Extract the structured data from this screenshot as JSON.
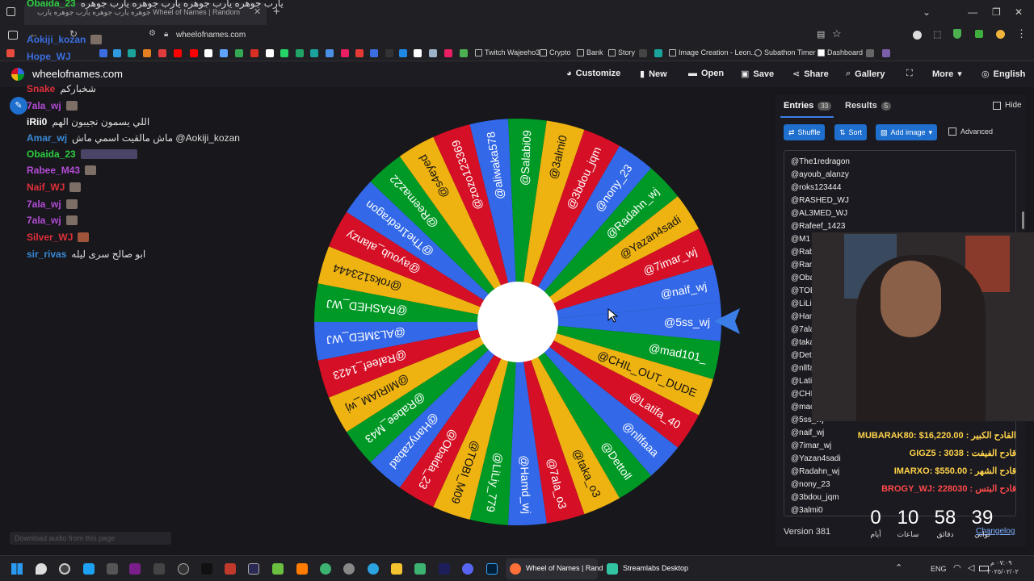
{
  "browser": {
    "tab_title": "جوهره يارب جوهره يارب جوهره يارب Wheel of Names | Random",
    "url": "wheelofnames.com",
    "bookmarks": [
      "Twitch Wajeeho3",
      "Crypto",
      "Bank",
      "Story",
      "Image Creation - Leon...",
      "Subathon Timer",
      "Dashboard"
    ]
  },
  "site": {
    "logo": "wheelofnames.com",
    "nav": [
      {
        "label": "Customize",
        "icon": "palette-icon"
      },
      {
        "label": "New",
        "icon": "file-icon"
      },
      {
        "label": "Open",
        "icon": "folder-icon"
      },
      {
        "label": "Save",
        "icon": "save-icon"
      },
      {
        "label": "Share",
        "icon": "share-icon"
      },
      {
        "label": "Gallery",
        "icon": "search-icon"
      },
      {
        "label": "More",
        "icon": "chevron-down-icon"
      },
      {
        "label": "English",
        "icon": "globe-icon"
      }
    ]
  },
  "chat": [
    {
      "user": "Obaida_23",
      "color": "#2ecc40",
      "msg": "يارب جوهره يارب جوهره يارب جوهره يارب جوهره"
    },
    {
      "user": "Aokiji_kozan",
      "color": "#3b6ee0",
      "msg": ""
    },
    {
      "user": "Hope_WJ",
      "color": "#3b6ee0",
      "msg": ""
    },
    {
      "user": "Snake",
      "color": "#e0303a",
      "msg": "شخباركم"
    },
    {
      "user": "7ala_wj",
      "color": "#b44cd6",
      "msg": ""
    },
    {
      "user": "iRii0",
      "color": "#ffffff",
      "msg": "اللي يسمون نجيبون الهم"
    },
    {
      "user": "Amar_wj",
      "color": "#3a8ad6",
      "msg": "ماش مالقيت اسمي ماش @Aokiji_kozan"
    },
    {
      "user": "Obaida_23",
      "color": "#2ecc40",
      "msg": ""
    },
    {
      "user": "Rabee_M43",
      "color": "#b44cd6",
      "msg": ""
    },
    {
      "user": "Naif_WJ",
      "color": "#e0303a",
      "msg": ""
    },
    {
      "user": "7ala_wj",
      "color": "#b44cd6",
      "msg": ""
    },
    {
      "user": "7ala_wj",
      "color": "#b44cd6",
      "msg": ""
    },
    {
      "user": "Silver_WJ",
      "color": "#e0303a",
      "msg": ""
    },
    {
      "user": "sir_rivas",
      "color": "#3a8ad6",
      "msg": "ابو صالح سرى ليله"
    }
  ],
  "wheel": {
    "colors": [
      "#3369e8",
      "#009925",
      "#eeb211",
      "#d50f25"
    ],
    "segments": [
      "@5ss_wj",
      "@mad101_",
      "@CHIL_OUT_DUDE",
      "@Latifa_40",
      "@nllfaaa",
      "@Dettoll",
      "@taka_o3",
      "@7ala_o3",
      "@Hamd_wj",
      "@LiLiy_779",
      "@TOBI_M09",
      "@Obaida_23",
      "@Hanyzabad",
      "@Rabee_M43",
      "@MIRIAM_wj",
      "@Rafeef_1423",
      "@AL3MED_WJ",
      "@RASHED_WJ",
      "@roks123444",
      "@ayoub_alanzy",
      "@The1redragon",
      "@Reemaz22",
      "@s4eyed",
      "@zozo123369",
      "@aliwaka578",
      "@Salabi09",
      "@3almi0",
      "@3bdou_jqm",
      "@nony_23",
      "@Radahn_wj",
      "@Yazan4sadi",
      "@7imar_wj",
      "@naif_wj"
    ]
  },
  "panel": {
    "tab_entries": "Entries",
    "entries_count": "33",
    "tab_results": "Results",
    "results_count": "5",
    "hide": "Hide",
    "shuffle": "Shuffle",
    "sort": "Sort",
    "add_image": "Add image",
    "advanced": "Advanced",
    "entries_list": [
      "@The1redragon",
      "@ayoub_alanzy",
      "@roks123444",
      "@RASHED_WJ",
      "@AL3MED_WJ",
      "@Rafeef_1423",
      "@M1",
      "@Rab",
      "@Ran",
      "@Oba",
      "@TOB",
      "@LiLi",
      "@Han",
      "@7ala",
      "@taka",
      "@Det",
      "@nllfa",
      "@Lati",
      "@CHI",
      "@mac",
      "@5ss_wj",
      "@naif_wj",
      "@7imar_wj",
      "@Yazan4sadi",
      "@Radahn_wj",
      "@nony_23",
      "@3bdou_jqm",
      "@3almi0"
    ],
    "version": "Version 381",
    "changelog": "Changelog"
  },
  "overlay": {
    "donations": [
      {
        "text": "MUBARAK80: $16,220.00 : القادح الكبير",
        "color": "#ffd24a"
      },
      {
        "text": "GIGZ5 : 3038 : قادح الفيفت",
        "color": "#ffd24a"
      },
      {
        "text": "IMARXO: $550.00 : قادح الشهر",
        "color": "#ffd24a"
      },
      {
        "text": "BROGY_WJ: 228030 : قادح البتس",
        "color": "#ff4a4a"
      }
    ],
    "timer": [
      {
        "num": "0",
        "label": "أيام"
      },
      {
        "num": "10",
        "label": "ساعات"
      },
      {
        "num": "58",
        "label": "دقائق"
      },
      {
        "num": "39",
        "label": "ثواني"
      }
    ],
    "download_hint": "Download audio from this page"
  },
  "taskbar": {
    "firefox_title": "Wheel of Names | Rand",
    "streamlabs_title": "Streamlabs Desktop",
    "lang": "ENG",
    "time": "٠٧:٠٩ م",
    "date": "٢٠٢٥/٠٢/٠٢"
  }
}
